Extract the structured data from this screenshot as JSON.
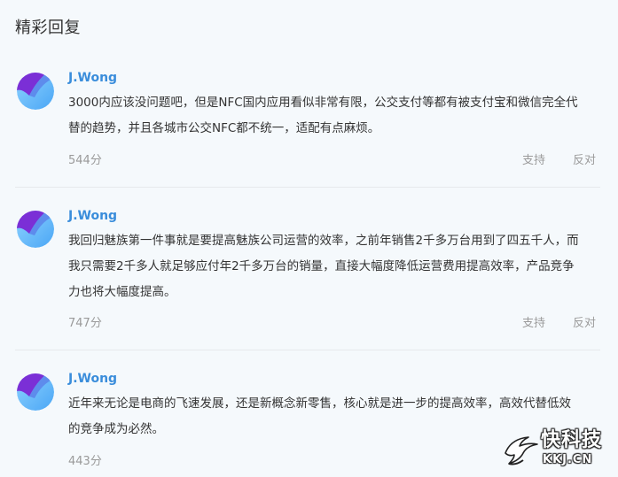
{
  "section_title": "精彩回复",
  "colors": {
    "accent": "#3a8ddb",
    "muted": "#9a9a9a",
    "background": "#f5f9fc",
    "divider": "#e6e9ec"
  },
  "comments": [
    {
      "user": "J.Wong",
      "avatar_icon": "user-avatar",
      "lines": [
        "3000内应该没问题吧，但是NFC国内应用看似非常有限，公交支付等都有被支付宝和微信完全代",
        "替的趋势，并且各城市公交NFC都不统一，适配有点麻烦。"
      ],
      "score": "544分",
      "support_label": "支持",
      "oppose_label": "反对"
    },
    {
      "user": "J.Wong",
      "avatar_icon": "user-avatar",
      "lines": [
        "我回归魅族第一件事就是要提高魅族公司运营的效率，之前年销售2千多万台用到了四五千人，而",
        "我只需要2千多人就足够应付年2千多万台的销量，直接大幅度降低运营费用提高效率，产品竞争",
        "力也将大幅度提高。"
      ],
      "score": "747分",
      "support_label": "支持",
      "oppose_label": "反对"
    },
    {
      "user": "J.Wong",
      "avatar_icon": "user-avatar",
      "lines": [
        "近年来无论是电商的飞速发展，还是新概念新零售，核心就是进一步的提高效率，高效代替低效",
        "的竞争成为必然。"
      ],
      "score": "443分",
      "support_label": "",
      "oppose_label": ""
    }
  ],
  "watermark": {
    "brand": "快科技",
    "domain": "KKJ.CN",
    "icon": "kkj-logo-icon"
  }
}
